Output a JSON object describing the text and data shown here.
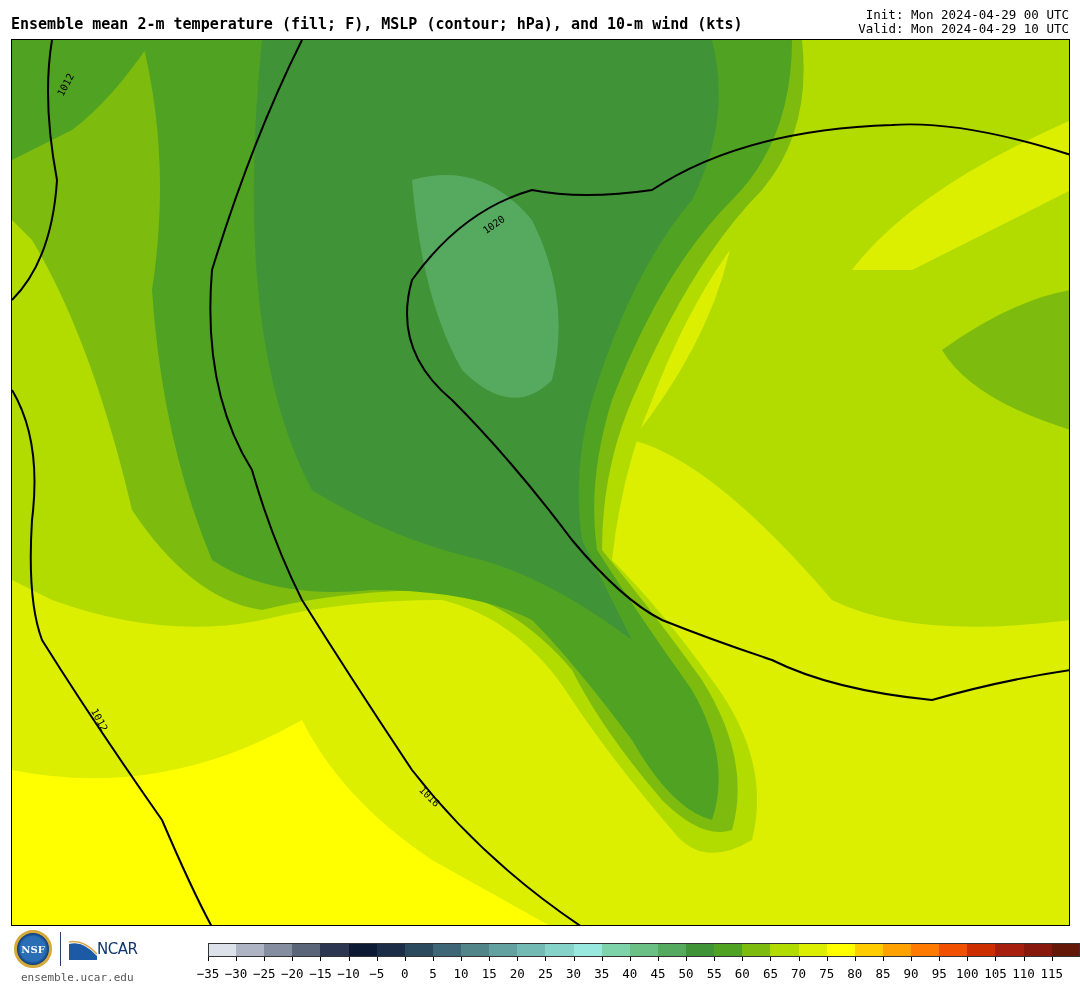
{
  "title": "Ensemble mean 2-m temperature (fill; F), MSLP (contour; hPa), and 10-m wind (kts)",
  "init": "Init: Mon 2024-04-29 00 UTC",
  "valid": "Valid: Mon 2024-04-29 10 UTC",
  "map": {
    "contour_labels": [
      "1012",
      "1020",
      "1012",
      "1016"
    ]
  },
  "logos": {
    "nsf_text": "NSF",
    "ncar_text": "NCAR",
    "site": "ensemble.ucar.edu"
  },
  "colorbar": [
    {
      "color": "#dde1ea",
      "label": "−35"
    },
    {
      "color": "#aeb4c3",
      "label": "−30"
    },
    {
      "color": "#858ea0",
      "label": "−25"
    },
    {
      "color": "#5b6579",
      "label": "−20"
    },
    {
      "color": "#2c3650",
      "label": "−15"
    },
    {
      "color": "#0c1a33",
      "label": "−10"
    },
    {
      "color": "#1b2d47",
      "label": "−5"
    },
    {
      "color": "#2b4a5e",
      "label": "0"
    },
    {
      "color": "#3f6676",
      "label": "5"
    },
    {
      "color": "#52858a",
      "label": "10"
    },
    {
      "color": "#62a1a0",
      "label": "15"
    },
    {
      "color": "#73b9b4",
      "label": "20"
    },
    {
      "color": "#86d3ca",
      "label": "25"
    },
    {
      "color": "#98e8e0",
      "label": "30"
    },
    {
      "color": "#7fd3aa",
      "label": "35"
    },
    {
      "color": "#6bc086",
      "label": "40"
    },
    {
      "color": "#56aa5f",
      "label": "45"
    },
    {
      "color": "#419338",
      "label": "50"
    },
    {
      "color": "#4fa222",
      "label": "55"
    },
    {
      "color": "#7dbc0e",
      "label": "60"
    },
    {
      "color": "#b2dc00",
      "label": "65"
    },
    {
      "color": "#dcef00",
      "label": "70"
    },
    {
      "color": "#ffff00",
      "label": "75"
    },
    {
      "color": "#ffcc00",
      "label": "80"
    },
    {
      "color": "#ffa100",
      "label": "85"
    },
    {
      "color": "#ff7a00",
      "label": "90"
    },
    {
      "color": "#f05000",
      "label": "95"
    },
    {
      "color": "#cd2e00",
      "label": "100"
    },
    {
      "color": "#a61f0e",
      "label": "105"
    },
    {
      "color": "#86180e",
      "label": "110"
    },
    {
      "color": "#641808",
      "label": "115"
    }
  ]
}
